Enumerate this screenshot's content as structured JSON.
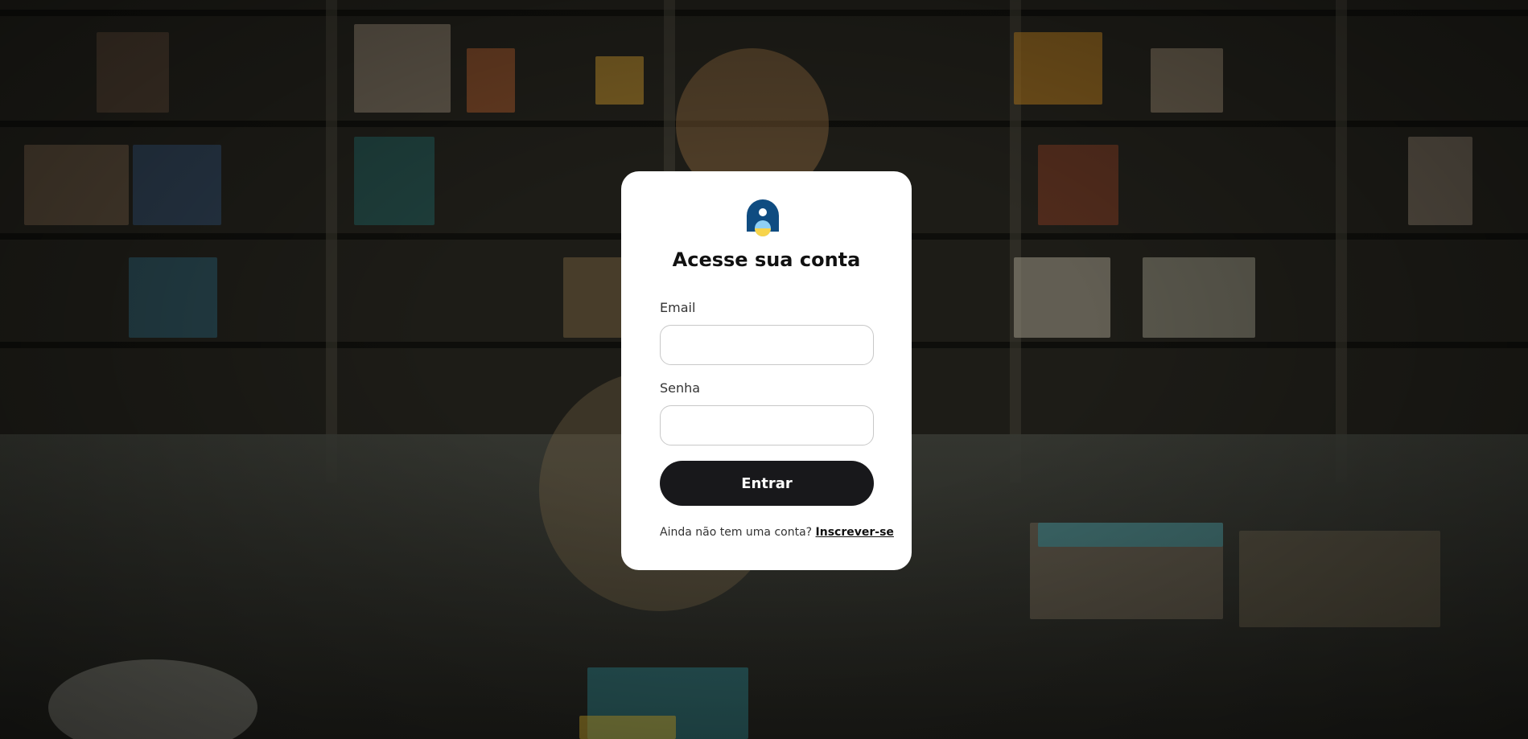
{
  "login": {
    "title": "Acesse sua conta",
    "email_label": "Email",
    "email_value": "",
    "password_label": "Senha",
    "password_value": "",
    "submit_label": "Entrar",
    "signup_prompt": "Ainda não tem uma conta?",
    "signup_link": "Inscrever-se"
  },
  "logo": {
    "icon": "person-logo-icon",
    "colors": {
      "shape": "#0f4c81",
      "head": "#ffffff",
      "circle_top": "#8fd0f5",
      "circle_bottom": "#f7d44c"
    }
  },
  "colors": {
    "card": "#ffffff",
    "button": "#18181b",
    "button_text": "#ffffff",
    "background": "#1d1c17"
  }
}
